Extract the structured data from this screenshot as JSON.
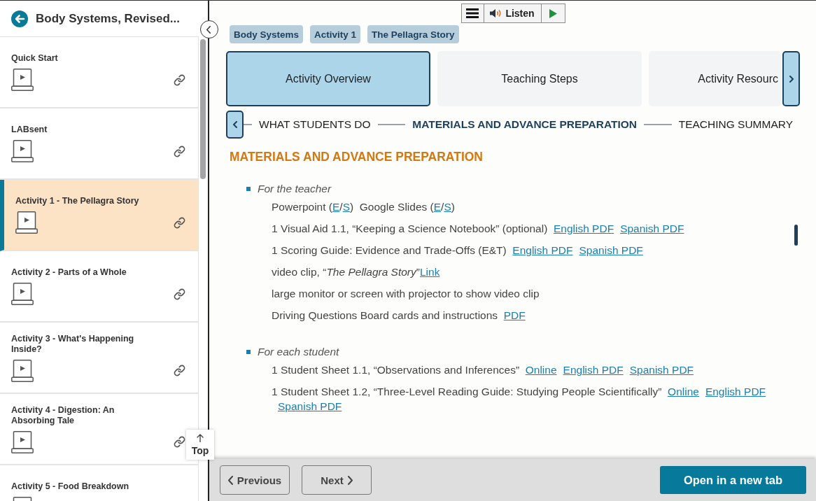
{
  "sidebar": {
    "title": "Body Systems, Revised...",
    "items": [
      {
        "title": "Quick Start",
        "selected": false
      },
      {
        "title": "LABsent",
        "selected": false
      },
      {
        "title": "Activity 1 - The Pellagra Story",
        "selected": true
      },
      {
        "title": "Activity 2 - Parts of a Whole",
        "selected": false
      },
      {
        "title": "Activity 3 - What's Happening Inside?",
        "selected": false
      },
      {
        "title": "Activity 4 - Digestion: An Absorbing Tale",
        "selected": false
      },
      {
        "title": "Activity 5 - Food Breakdown",
        "selected": false
      }
    ]
  },
  "top_button": {
    "label": "Top"
  },
  "listen_toolbar": {
    "label": "Listen"
  },
  "breadcrumbs": [
    "Body Systems",
    "Activity 1",
    "The Pellagra Story"
  ],
  "tabs": [
    {
      "label": "Activity Overview",
      "selected": true
    },
    {
      "label": "Teaching Steps",
      "selected": false
    },
    {
      "label": "Activity Resourc",
      "selected": false
    }
  ],
  "steps": [
    {
      "label": "WHAT STUDENTS DO",
      "selected": false
    },
    {
      "label": "MATERIALS AND ADVANCE PREPARATION",
      "selected": true
    },
    {
      "label": "TEACHING SUMMARY",
      "selected": false
    }
  ],
  "materials": {
    "heading": "MATERIALS AND ADVANCE PREPARATION",
    "groups": [
      {
        "title": "For the teacher",
        "lines": [
          {
            "parts": [
              {
                "kind": "text",
                "text": "Powerpoint ("
              },
              {
                "kind": "link",
                "text": "E"
              },
              {
                "kind": "text",
                "text": "/"
              },
              {
                "kind": "link",
                "text": "S"
              },
              {
                "kind": "text",
                "text": ")  Google Slides ("
              },
              {
                "kind": "link",
                "text": "E"
              },
              {
                "kind": "text",
                "text": "/"
              },
              {
                "kind": "link",
                "text": "S"
              },
              {
                "kind": "text",
                "text": ")"
              }
            ]
          },
          {
            "parts": [
              {
                "kind": "text",
                "text": "1 Visual Aid 1.1, “Keeping a Science Notebook” (optional)  "
              },
              {
                "kind": "link",
                "text": "English PDF"
              },
              {
                "kind": "link",
                "text": "Spanish PDF"
              }
            ]
          },
          {
            "parts": [
              {
                "kind": "text",
                "text": "1 Scoring Guide: Evidence and Trade-Offs (E&T)  "
              },
              {
                "kind": "link",
                "text": "English PDF"
              },
              {
                "kind": "link",
                "text": "Spanish PDF"
              }
            ]
          },
          {
            "parts": [
              {
                "kind": "text",
                "text": "video clip, “*The Pellagra Story*”"
              },
              {
                "kind": "link",
                "text": "Link"
              }
            ]
          },
          {
            "parts": [
              {
                "kind": "text",
                "text": "large monitor or screen with projector to show video clip"
              }
            ]
          },
          {
            "parts": [
              {
                "kind": "text",
                "text": "Driving Questions Board cards and instructions  "
              },
              {
                "kind": "link",
                "text": "PDF"
              }
            ]
          }
        ]
      },
      {
        "title": "For each student",
        "lines": [
          {
            "parts": [
              {
                "kind": "text",
                "text": "1 Student Sheet 1.1, “Observations and Inferences”  "
              },
              {
                "kind": "link",
                "text": "Online"
              },
              {
                "kind": "link",
                "text": "English PDF"
              },
              {
                "kind": "link",
                "text": "Spanish PDF"
              }
            ]
          },
          {
            "parts": [
              {
                "kind": "text",
                "text": "1 Student Sheet 1.2, “Three-Level Reading Guide: Studying People Scientifically”  "
              },
              {
                "kind": "link",
                "text": "Online"
              },
              {
                "kind": "link",
                "text": "English PDF"
              },
              {
                "kind": "link",
                "text": "Spanish PDF"
              }
            ]
          }
        ]
      }
    ]
  },
  "footer": {
    "previous": "Previous",
    "next": "Next",
    "open": "Open in a new tab"
  }
}
